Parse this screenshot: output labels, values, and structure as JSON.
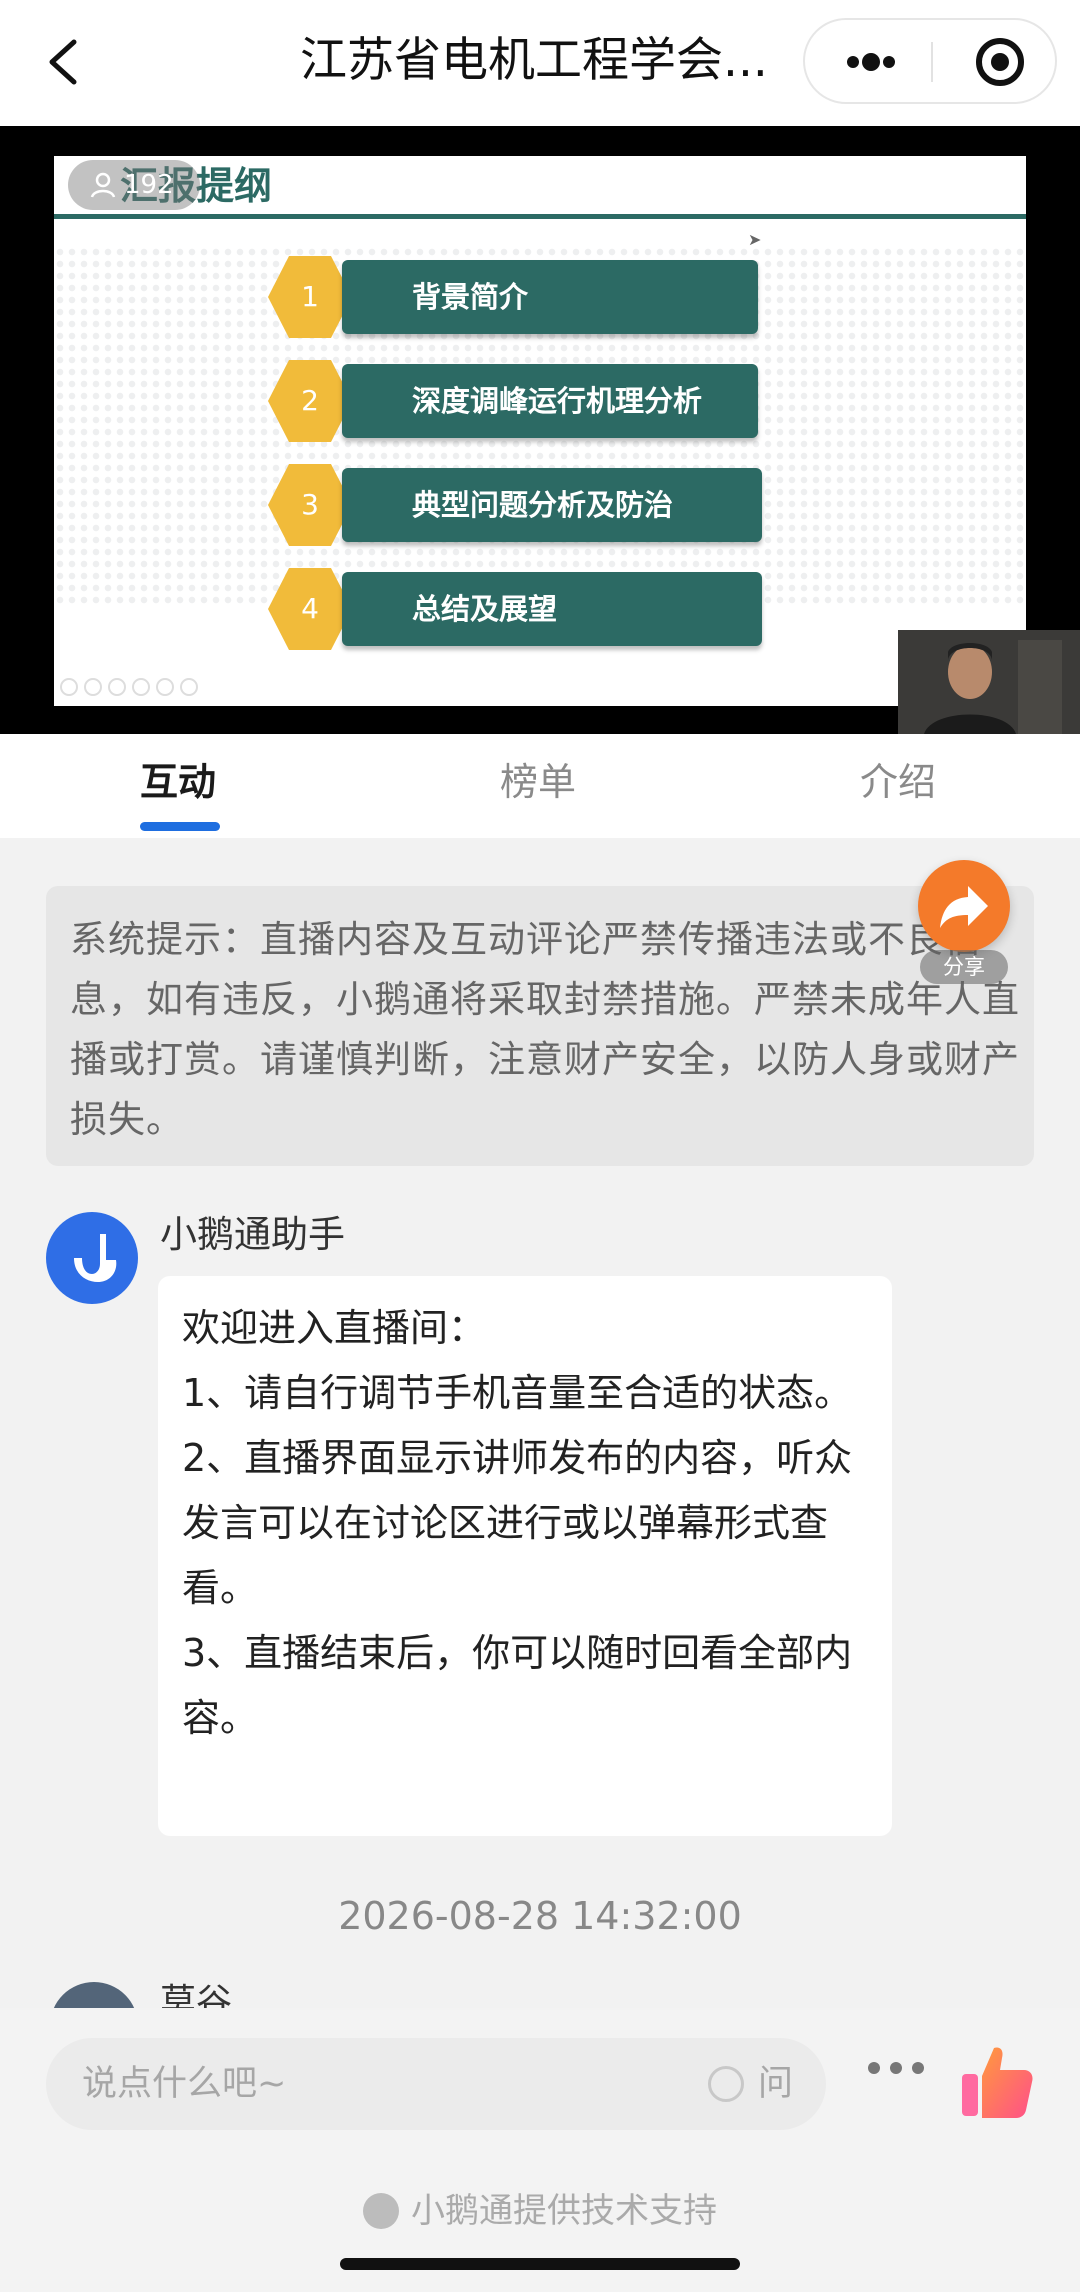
{
  "header": {
    "title": "江苏省电机工程学会...",
    "back_icon": "chevron-left-icon",
    "more_icon": "more-dots-icon",
    "close_icon": "target-circle-icon"
  },
  "video": {
    "viewer_count": "192",
    "slide": {
      "heading": "汇报提纲",
      "items": [
        {
          "num": "1",
          "label": "背景简介"
        },
        {
          "num": "2",
          "label": "深度调峰运行机理分析"
        },
        {
          "num": "3",
          "label": "典型问题分析及防治"
        },
        {
          "num": "4",
          "label": "总结及展望"
        }
      ],
      "colors": {
        "teal": "#2c6a64",
        "gold": "#f1bb3a"
      }
    }
  },
  "tabs": [
    {
      "label": "互动",
      "active": true
    },
    {
      "label": "榜单",
      "active": false
    },
    {
      "label": "介绍",
      "active": false
    }
  ],
  "notice": {
    "text": "系统提示：直播内容及互动评论严禁传播违法或不良信息，如有违反，小鹅通将采取封禁措施。严禁未成年人直播或打赏。请谨慎判断，注意财产安全，以防人身或财产损失。"
  },
  "share": {
    "label": "分享",
    "icon": "share-arrow-icon",
    "color": "#f47a2a"
  },
  "messages": [
    {
      "sender": "小鹅通助手",
      "avatar_icon": "goose-icon",
      "text": "欢迎进入直播间：\n1、请自行调节手机音量至合适的状态。\n2、直播界面显示讲师发布的内容，听众发言可以在讨论区进行或以弹幕形式查看。\n3、直播结束后，你可以随时回看全部内容。"
    }
  ],
  "timestamp": "2026-08-28 14:32:00",
  "partial_message": {
    "sender": "莫谷"
  },
  "composer": {
    "placeholder": "说点什么吧~",
    "ask_label": "问",
    "more_icon": "more-horizontal-icon",
    "like_icon": "thumbs-up-icon"
  },
  "footer": {
    "support_text": "小鹅通提供技术支持"
  },
  "accent_color": "#1e6ee0"
}
